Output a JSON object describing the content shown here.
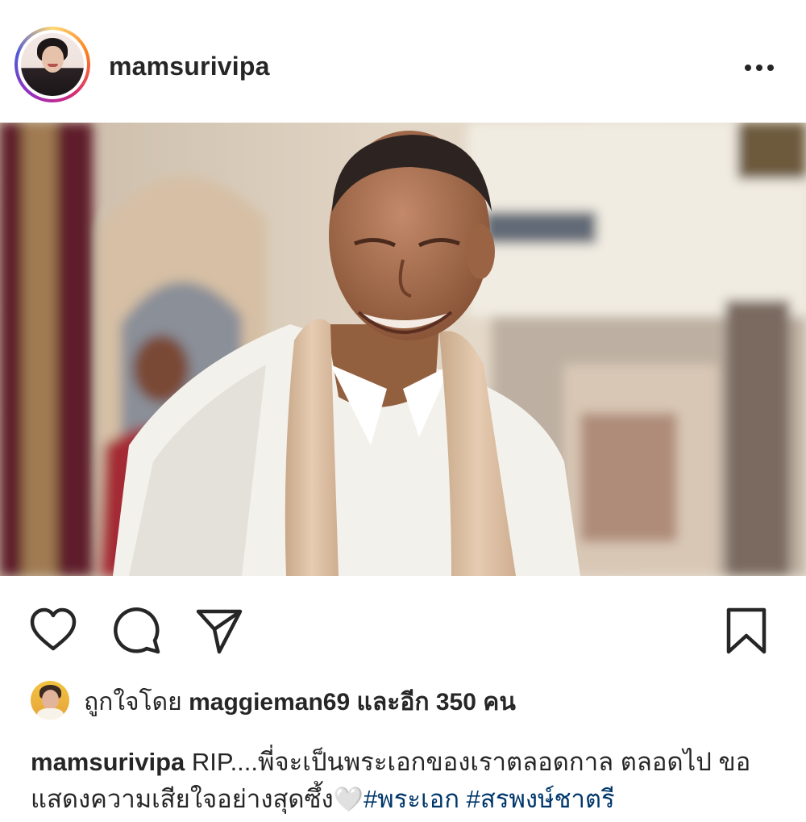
{
  "post": {
    "username": "mamsurivipa",
    "more_icon": "more-horizontal-icon"
  },
  "photo": {
    "icon": "post-photo"
  },
  "actions": {
    "like_icon": "heart-icon",
    "comment_icon": "comment-icon",
    "share_icon": "send-icon",
    "save_icon": "bookmark-icon"
  },
  "likes": {
    "prefix": "ถูกใจโดย",
    "user": "maggieman69",
    "and_more": "และอีก",
    "count": "350",
    "unit": "คน"
  },
  "caption": {
    "username": "mamsurivipa",
    "text": "RIP....พี่จะเป็นพระเอกของเราตลอดกาล ตลอดไป ขอแสดงความเสียใจอย่างสุดซึ้ง",
    "emoji": "🤍",
    "hashtags": [
      "#พระเอก",
      "#สรพงษ์ชาตรี"
    ]
  },
  "colors": {
    "text": "#262626",
    "hashtag": "#00376b",
    "ring_start": "#feda75",
    "ring_end": "#962fbf"
  }
}
